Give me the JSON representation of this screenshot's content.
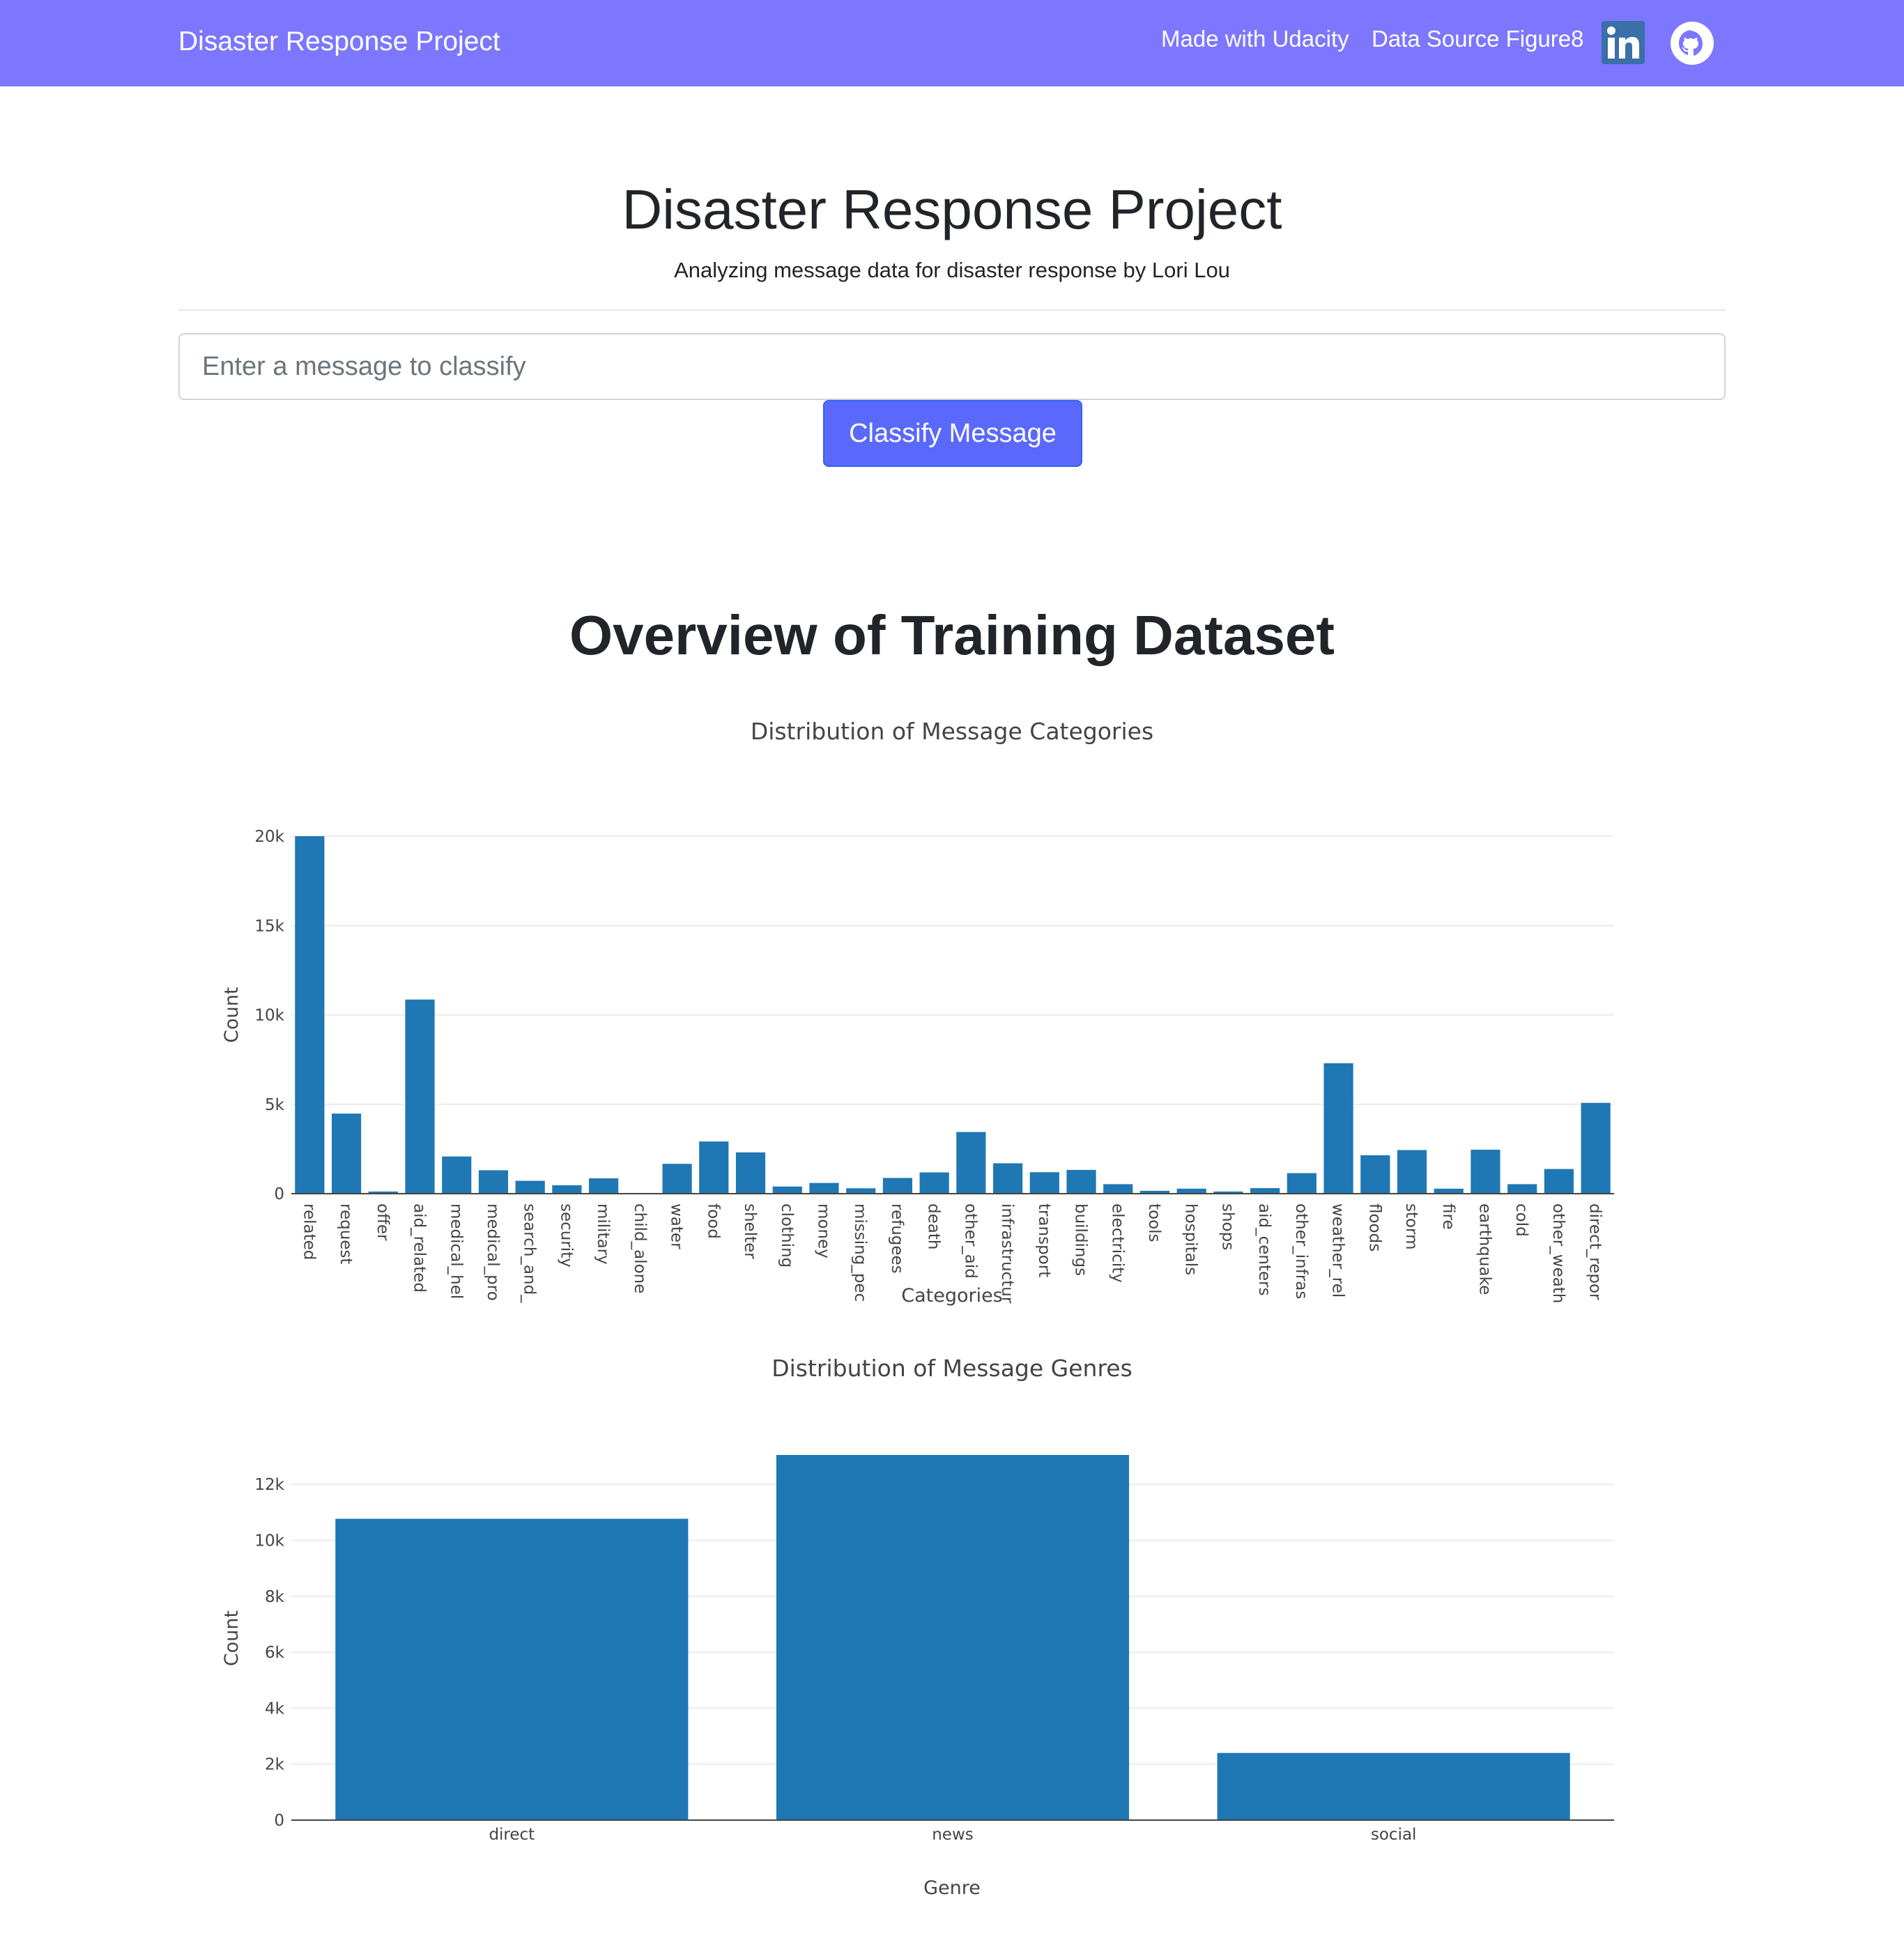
{
  "navbar": {
    "brand": "Disaster Response Project",
    "links": [
      "Made with Udacity",
      "Data Source Figure8"
    ],
    "icons": [
      "linkedin-icon",
      "github-icon"
    ],
    "background_color": "#7d76fe"
  },
  "header": {
    "title": "Disaster Response Project",
    "subtitle": "Analyzing message data for disaster response by Lori Lou"
  },
  "form": {
    "input_value": "",
    "input_placeholder": "Enter a message to classify",
    "button_label": "Classify Message",
    "button_color": "#5a69fc"
  },
  "overview": {
    "title": "Overview of Training Dataset"
  },
  "chart_data": [
    {
      "type": "bar",
      "title": "Distribution of Message Categories",
      "xlabel": "Categories",
      "ylabel": "Count",
      "ylim": [
        0,
        20000
      ],
      "yticks": [
        0,
        5000,
        10000,
        15000,
        20000
      ],
      "ytick_labels": [
        "0",
        "5k",
        "10k",
        "15k",
        "20k"
      ],
      "grid": true,
      "bar_color": "#1f77b4",
      "categories": [
        "related",
        "request",
        "offer",
        "aid_related",
        "medical_hel",
        "medical_pro",
        "search_and_",
        "security",
        "military",
        "child_alone",
        "water",
        "food",
        "shelter",
        "clothing",
        "money",
        "missing_pec",
        "refugees",
        "death",
        "other_aid",
        "infrastructur",
        "transport",
        "buildings",
        "electricity",
        "tools",
        "hospitals",
        "shops",
        "aid_centers",
        "other_infras",
        "weather_rel",
        "floods",
        "storm",
        "fire",
        "earthquake",
        "cold",
        "other_weath",
        "direct_repor"
      ],
      "values": [
        20000,
        4480,
        120,
        10860,
        2080,
        1310,
        720,
        470,
        860,
        0,
        1670,
        2920,
        2310,
        400,
        600,
        300,
        880,
        1190,
        3450,
        1700,
        1200,
        1330,
        530,
        160,
        280,
        120,
        310,
        1150,
        7300,
        2150,
        2440,
        280,
        2460,
        530,
        1380,
        5080
      ]
    },
    {
      "type": "bar",
      "title": "Distribution of Message Genres",
      "xlabel": "Genre",
      "ylabel": "Count",
      "ylim": [
        0,
        13000
      ],
      "yticks": [
        0,
        2000,
        4000,
        6000,
        8000,
        10000,
        12000
      ],
      "ytick_labels": [
        "0",
        "2k",
        "4k",
        "6k",
        "8k",
        "10k",
        "12k"
      ],
      "grid": true,
      "bar_color": "#1f77b4",
      "categories": [
        "direct",
        "news",
        "social"
      ],
      "values": [
        10770,
        13050,
        2400
      ]
    }
  ]
}
